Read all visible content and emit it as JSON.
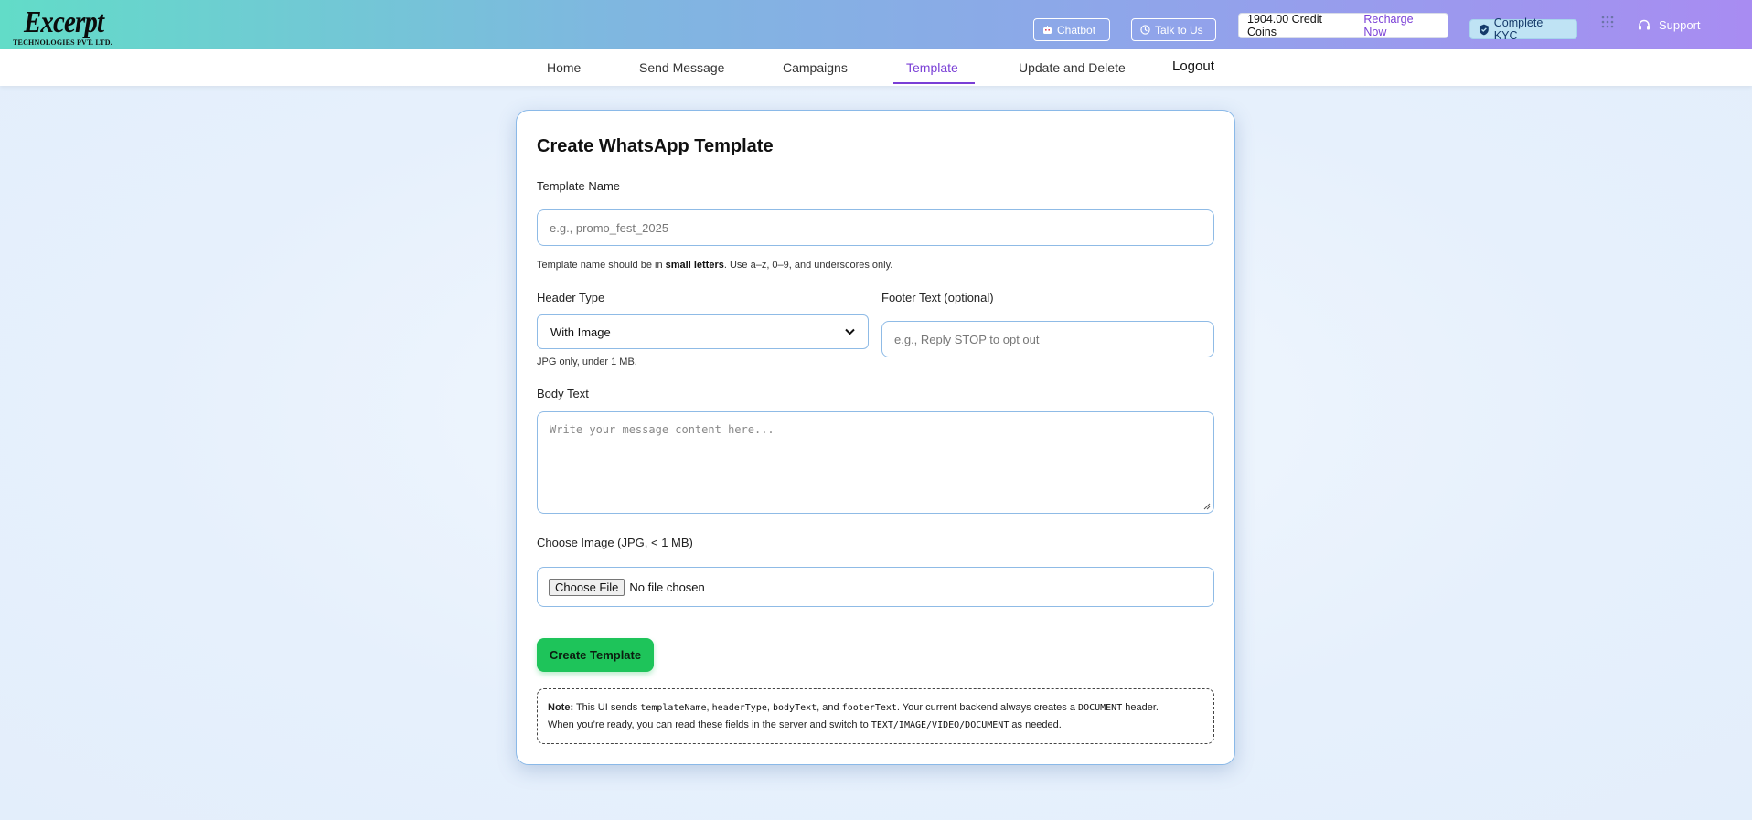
{
  "brand": {
    "name": "Excerpt",
    "sub": "TECHNOLOGIES PVT. LTD."
  },
  "topbar": {
    "chatbot_label": "Chatbot",
    "talk_label": "Talk to Us",
    "credits_text": "1904.00 Credit Coins",
    "recharge_label": "Recharge Now",
    "kyc_label": "Complete KYC",
    "support_label": "Support"
  },
  "nav": {
    "items": [
      {
        "label": "Home"
      },
      {
        "label": "Send Message"
      },
      {
        "label": "Campaigns"
      },
      {
        "label": "Template",
        "active": true
      },
      {
        "label": "Update and Delete"
      },
      {
        "label": "Logout"
      }
    ]
  },
  "form": {
    "title": "Create WhatsApp Template",
    "template_name_label": "Template Name",
    "template_name_placeholder": "e.g., promo_fest_2025",
    "template_hint_pre": "Template name should be in ",
    "template_hint_bold": "small letters",
    "template_hint_post": ". Use a–z, 0–9, and underscores only.",
    "header_type_label": "Header Type",
    "header_type_value": "With Image",
    "header_hint": "JPG only, under 1 MB.",
    "footer_label": "Footer Text (optional)",
    "footer_placeholder": "e.g., Reply STOP to opt out",
    "body_label": "Body Text",
    "body_placeholder": "Write your message content here...",
    "image_label": "Choose Image (JPG, < 1 MB)",
    "file_button": "Choose File",
    "file_status": "No file chosen",
    "submit_label": "Create Template"
  },
  "note": {
    "lead": "Note:",
    "t1": " This UI sends ",
    "c1": "templateName",
    "t2": ", ",
    "c2": "headerType",
    "t3": ", ",
    "c3": "bodyText",
    "t4": ", and ",
    "c4": "footerText",
    "t5": ". Your current backend always creates a ",
    "c5": "DOCUMENT",
    "t6": " header.",
    "t7": "When you’re ready, you can read these fields in the server and switch to ",
    "c6": "TEXT/IMAGE/VIDEO/DOCUMENT",
    "t8": " as needed."
  },
  "colors": {
    "accent": "#7a3fd6",
    "primary_button": "#1ec45a",
    "input_border": "#8fbbe6"
  }
}
